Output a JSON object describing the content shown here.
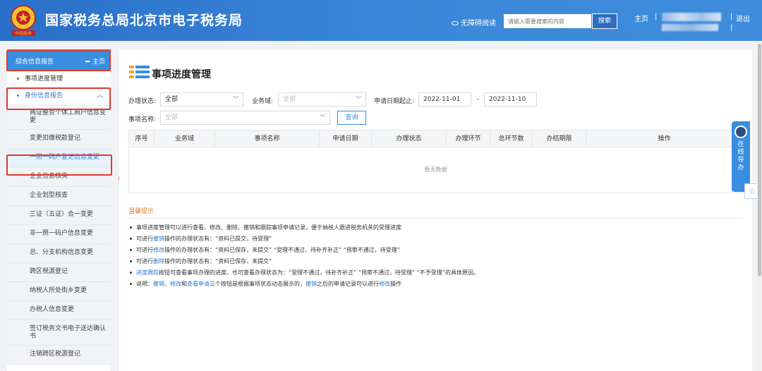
{
  "header": {
    "site_title": "国家税务总局北京市电子税务局",
    "emblem_caption": "中国税务",
    "accessibility_label": "无障碍阅读",
    "search_placeholder": "请输入需要搜索的内容",
    "search_button": "搜索",
    "home_link": "主页",
    "separator": "|",
    "logout": "退出"
  },
  "sidebar": {
    "top_title": "综合信息报告",
    "top_home": "主页",
    "top_home_icon": "reply-arrow-icon",
    "items": [
      {
        "label": "事项进度管理"
      },
      {
        "label": "身份信息报告",
        "expanded": true
      }
    ],
    "sub_items": [
      {
        "label": "两证整合个体工商户信息变更"
      },
      {
        "label": "变更扣缴税款登记"
      },
      {
        "label": "一照一码户登记信息变更",
        "selected": true
      },
      {
        "label": "企业信息核实"
      },
      {
        "label": "企业划型核查"
      },
      {
        "label": "三证（五证）合一变更"
      },
      {
        "label": "非一照一码户信息变更"
      },
      {
        "label": "总、分支机构信息变更"
      },
      {
        "label": "跨区税源登记"
      },
      {
        "label": "纳税人所处街乡变更"
      },
      {
        "label": "办税人信息变更"
      },
      {
        "label": "签订税务文书电子送达确认书"
      },
      {
        "label": "注销跨区税源登记"
      }
    ]
  },
  "main": {
    "title": "事项进度管理",
    "filters": {
      "status_label": "办理状态:",
      "status_value": "全部",
      "domain_label": "业务域:",
      "domain_placeholder": "全部",
      "date_label": "申请日期起止:",
      "date_from": "2022-11-01",
      "date_dash": "-",
      "date_to": "2022-11-10",
      "name_label": "事项名称:",
      "name_placeholder": "全部",
      "query_button": "查询"
    },
    "table": {
      "columns": [
        "序号",
        "业务域",
        "事项名称",
        "申请日期",
        "办理状态",
        "办理环节",
        "总环节数",
        "办结期限",
        "操作"
      ],
      "empty_text": "暂无数据"
    },
    "tips": {
      "title": "温馨提示",
      "lines": [
        [
          {
            "t": "事项进度管理可以进行查看、修改、删除、撤销和跟踪事项申请记录，便于纳税人跟进税务机关的受理进度"
          }
        ],
        [
          {
            "t": "可进行"
          },
          {
            "t": "撤销",
            "hl": true
          },
          {
            "t": "操作的办理状态有：“资料已提交，待受理”"
          }
        ],
        [
          {
            "t": "可进行"
          },
          {
            "t": "修改",
            "hl": true
          },
          {
            "t": "操作的办理状态有：“资料已保存，未提交”  “受理不通过，待补齐补正”  “预审不通过，待受理”"
          }
        ],
        [
          {
            "t": "可进行"
          },
          {
            "t": "删除",
            "hl": true
          },
          {
            "t": "操作的办理状态有：“资料已保存，未提交”"
          }
        ],
        [
          {
            "t": "进度跟踪",
            "hl": true
          },
          {
            "t": "按钮可查看事项办理的进度，也可查看办理状态为：“受理不通过，待补齐补正”  “预审不通过，待受理”  “不予受理”的具体原因。"
          }
        ],
        [
          {
            "t": "说明："
          },
          {
            "t": "撤销",
            "hl": true
          },
          {
            "t": "、"
          },
          {
            "t": "修改",
            "hl": true
          },
          {
            "t": "和"
          },
          {
            "t": "查看申请",
            "hl": true
          },
          {
            "t": "三个按钮是根据事项状态动态展示的，"
          },
          {
            "t": "撤销",
            "hl": true
          },
          {
            "t": "之后的申请记录可以进行"
          },
          {
            "t": "修改",
            "hl": true
          },
          {
            "t": "操作"
          }
        ]
      ]
    }
  },
  "float": {
    "guide_text": "在线导办",
    "user_icon": "user-star-icon"
  },
  "colors": {
    "header_blue": "#3b86d8",
    "accent": "#2d79d1",
    "annotation_red": "#e23a2e",
    "tip_orange": "#e27b2c"
  }
}
